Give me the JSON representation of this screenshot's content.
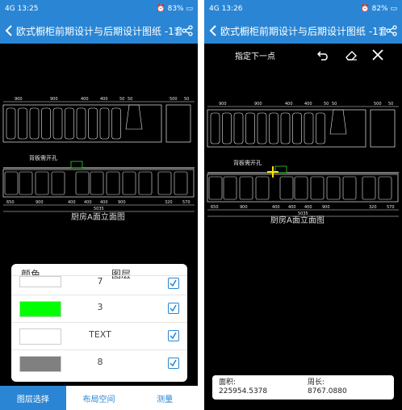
{
  "left": {
    "status": {
      "time": "13:25",
      "battery": "83%",
      "signal": "4G"
    },
    "title": "欧式橱柜前期设计与后期设计图纸 -1套",
    "drawing": {
      "caption": "厨房A面立面图",
      "note": "背板需开孔",
      "dim_top": [
        "900",
        "900",
        "400",
        "400",
        "50",
        "50",
        "500",
        "50"
      ],
      "dim_bottom": [
        "650",
        "900",
        "400",
        "400",
        "400",
        "900",
        "320",
        "570"
      ],
      "total": "5035"
    },
    "layer_panel": {
      "header_color": "颜色",
      "header_layer": "图层",
      "rows": [
        {
          "name": "7",
          "color": "#ffffff"
        },
        {
          "name": "3",
          "color": "#00ff00"
        },
        {
          "name": "TEXT",
          "color": "#ffffff"
        },
        {
          "name": "8",
          "color": "#808080"
        }
      ]
    },
    "tabs": [
      "图层选择",
      "布局空间",
      "测量"
    ]
  },
  "right": {
    "status": {
      "time": "13:26",
      "battery": "82%",
      "signal": "4G"
    },
    "title": "欧式橱柜前期设计与后期设计图纸 -1套",
    "prompt": "指定下一点",
    "drawing": {
      "caption": "厨房A面立面图",
      "note": "背板需开孔",
      "dim_top": [
        "900",
        "900",
        "400",
        "400",
        "50",
        "50",
        "500",
        "50"
      ],
      "dim_bottom": [
        "650",
        "900",
        "400",
        "400",
        "400",
        "900",
        "320",
        "570"
      ],
      "total": "5035"
    },
    "measure": {
      "area_label": "面积:",
      "area_value": "225954.5378",
      "perimeter_label": "周长:",
      "perimeter_value": "8767.0880"
    }
  },
  "colors": {
    "brand": "#2a86d4",
    "background": "#000000",
    "drawing_line": "#ffffff"
  }
}
